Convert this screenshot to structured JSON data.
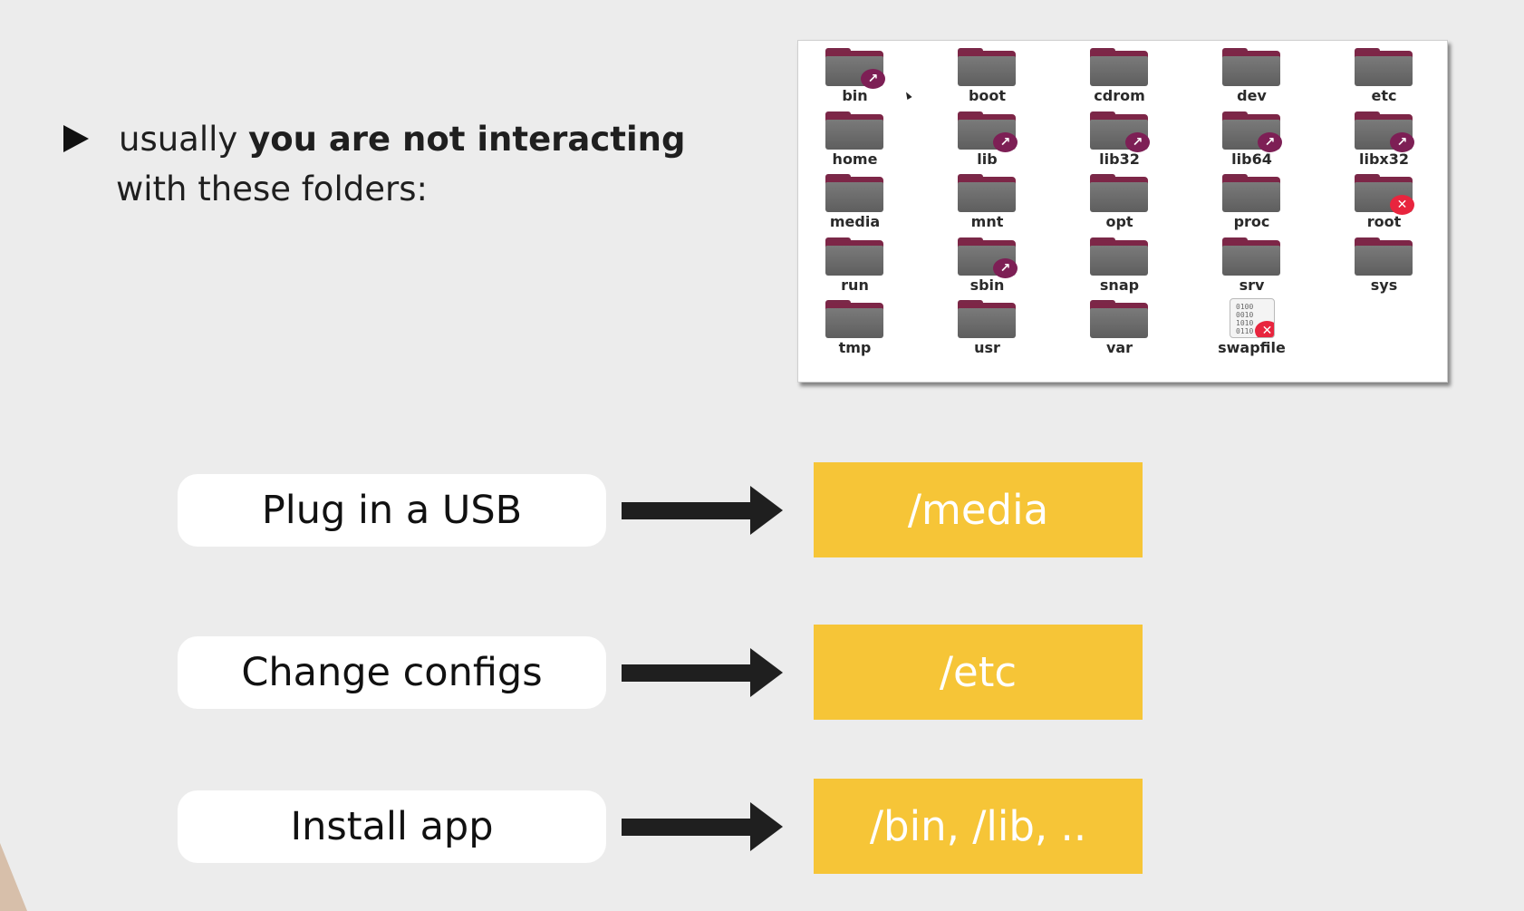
{
  "bullet": {
    "intro": "usually",
    "emphasis": "you are not interacting",
    "line2": "with these folders:"
  },
  "file_browser": {
    "items": [
      {
        "name": "bin",
        "type": "folder",
        "badge": "link"
      },
      {
        "name": "boot",
        "type": "folder",
        "badge": ""
      },
      {
        "name": "cdrom",
        "type": "folder",
        "badge": ""
      },
      {
        "name": "dev",
        "type": "folder",
        "badge": ""
      },
      {
        "name": "etc",
        "type": "folder",
        "badge": ""
      },
      {
        "name": "home",
        "type": "folder",
        "badge": ""
      },
      {
        "name": "lib",
        "type": "folder",
        "badge": "link"
      },
      {
        "name": "lib32",
        "type": "folder",
        "badge": "link"
      },
      {
        "name": "lib64",
        "type": "folder",
        "badge": "link"
      },
      {
        "name": "libx32",
        "type": "folder",
        "badge": "link"
      },
      {
        "name": "media",
        "type": "folder",
        "badge": ""
      },
      {
        "name": "mnt",
        "type": "folder",
        "badge": ""
      },
      {
        "name": "opt",
        "type": "folder",
        "badge": ""
      },
      {
        "name": "proc",
        "type": "folder",
        "badge": ""
      },
      {
        "name": "root",
        "type": "folder",
        "badge": "locked"
      },
      {
        "name": "run",
        "type": "folder",
        "badge": ""
      },
      {
        "name": "sbin",
        "type": "folder",
        "badge": "link"
      },
      {
        "name": "snap",
        "type": "folder",
        "badge": ""
      },
      {
        "name": "srv",
        "type": "folder",
        "badge": ""
      },
      {
        "name": "sys",
        "type": "folder",
        "badge": ""
      },
      {
        "name": "tmp",
        "type": "folder",
        "badge": ""
      },
      {
        "name": "usr",
        "type": "folder",
        "badge": ""
      },
      {
        "name": "var",
        "type": "folder",
        "badge": ""
      },
      {
        "name": "swapfile",
        "type": "binary-file",
        "badge": "locked"
      }
    ],
    "binary_glyph": "0100 0010 1010 0110",
    "colors": {
      "folder_gray": "#6b6b6b",
      "folder_tab": "#7d2647",
      "link_badge": "#7d1f55",
      "locked_badge": "#e8253e"
    }
  },
  "mappings": [
    {
      "action": "Plug in a USB",
      "target": "/media"
    },
    {
      "action": "Change configs",
      "target": "/etc"
    },
    {
      "action": "Install app",
      "target": "/bin, /lib, .."
    }
  ],
  "colors": {
    "target_box": "#f6c537",
    "background": "#ececec",
    "arrow": "#1f1f1f"
  }
}
